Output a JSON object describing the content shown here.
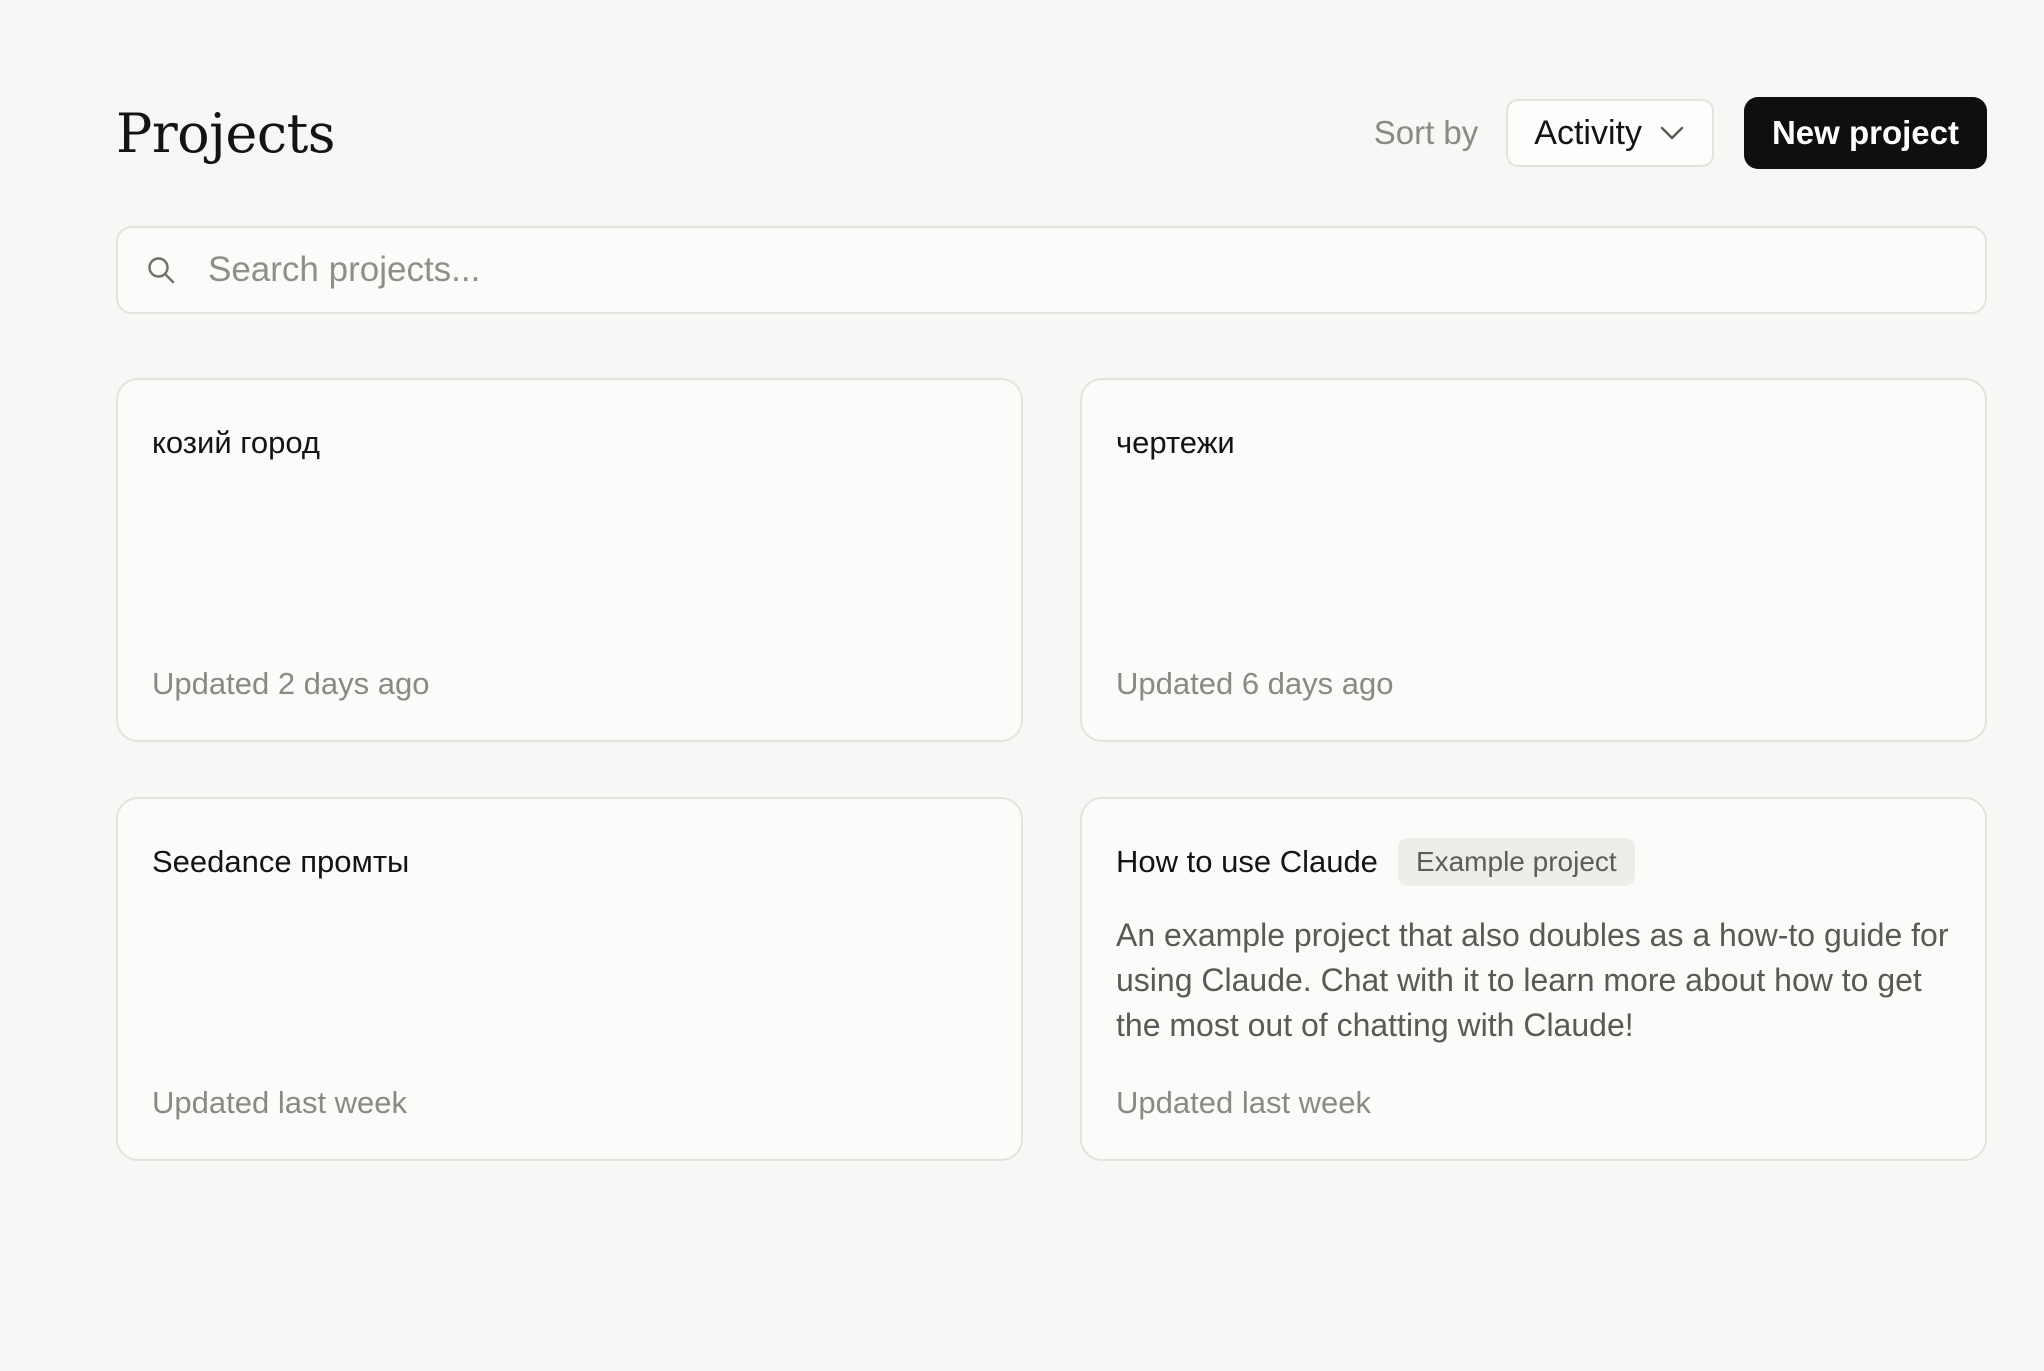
{
  "header": {
    "title": "Projects",
    "sort_label": "Sort by",
    "sort_value": "Activity",
    "new_project_label": "New project"
  },
  "search": {
    "placeholder": "Search projects..."
  },
  "projects": [
    {
      "title": "козий город",
      "badge": "",
      "description": "",
      "updated": "Updated 2 days ago"
    },
    {
      "title": "чертежи",
      "badge": "",
      "description": "",
      "updated": "Updated 6 days ago"
    },
    {
      "title": "Seedance промты",
      "badge": "",
      "description": "",
      "updated": "Updated last week"
    },
    {
      "title": "How to use Claude",
      "badge": "Example project",
      "description": "An example project that also doubles as a how-to guide for using Claude. Chat with it to learn more about how to get the most out of chatting with Claude!",
      "updated": "Updated last week"
    }
  ],
  "icons": {
    "search": "search-icon",
    "sort_chevron": "chevron-down-icon"
  },
  "colors": {
    "background": "#f7f7f5",
    "primary_button": "#0f0f0e",
    "border": "#e3e2de",
    "muted_text": "#8a8986"
  }
}
